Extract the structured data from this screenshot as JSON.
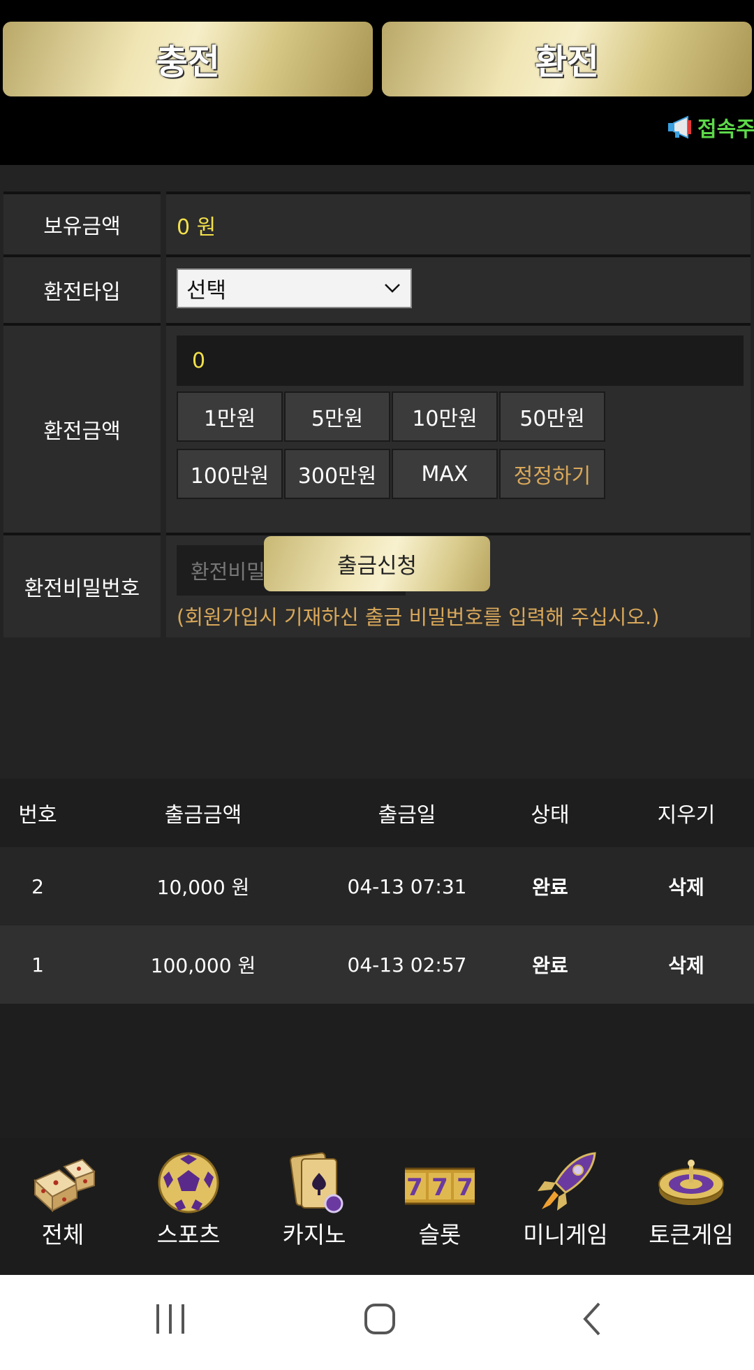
{
  "header": {
    "charge_label": "충전",
    "exchange_label": "환전",
    "notice_text": "접속주"
  },
  "form": {
    "balance": {
      "label": "보유금액",
      "value": "0 원"
    },
    "exchange_type": {
      "label": "환전타입",
      "selected": "선택"
    },
    "amount": {
      "label": "환전금액",
      "value": "0",
      "quick_buttons": [
        "1만원",
        "5만원",
        "10만원",
        "50만원",
        "100만원",
        "300만원",
        "MAX",
        "정정하기"
      ]
    },
    "password": {
      "label": "환전비밀번호",
      "placeholder": "환전비밀번호",
      "note": "(회원가입시 기재하신 출금 비밀번호를 입력해 주십시오.)"
    },
    "submit_label": "출금신청"
  },
  "history": {
    "headers": [
      "번호",
      "출금금액",
      "출금일",
      "상태",
      "지우기"
    ],
    "rows": [
      {
        "no": "2",
        "amount": "10,000 원",
        "date": "04-13 07:31",
        "status": "완료",
        "action": "삭제"
      },
      {
        "no": "1",
        "amount": "100,000 원",
        "date": "04-13 02:57",
        "status": "완료",
        "action": "삭제"
      }
    ]
  },
  "bottom_nav": [
    {
      "label": "전체",
      "icon": "dice-icon"
    },
    {
      "label": "스포츠",
      "icon": "soccer-ball-icon"
    },
    {
      "label": "카지노",
      "icon": "cards-icon"
    },
    {
      "label": "슬롯",
      "icon": "slot-777-icon"
    },
    {
      "label": "미니게임",
      "icon": "rocket-icon"
    },
    {
      "label": "토큰게임",
      "icon": "roulette-icon"
    }
  ],
  "colors": {
    "gold": "#e9dca4",
    "highlight_yellow": "#f2e04a",
    "note_orange": "#d9a85a",
    "notice_green": "#5cd84a"
  }
}
